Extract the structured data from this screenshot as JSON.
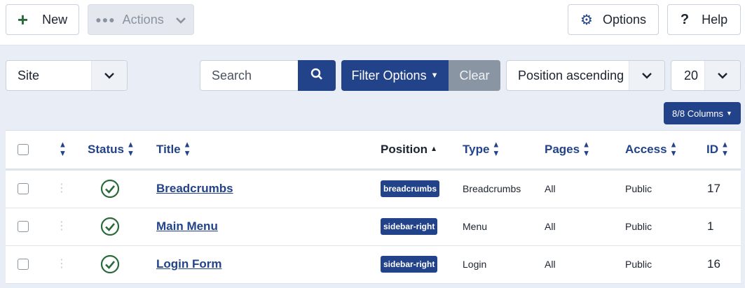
{
  "toolbar": {
    "new_label": "New",
    "actions_label": "Actions",
    "options_label": "Options",
    "help_label": "Help"
  },
  "filters": {
    "site_value": "Site",
    "search_placeholder": "Search",
    "filter_options_label": "Filter Options",
    "clear_label": "Clear",
    "ordering_value": "Position ascending",
    "limit_value": "20",
    "columns_label": "8/8 Columns"
  },
  "table": {
    "headers": {
      "status": "Status",
      "title": "Title",
      "position": "Position",
      "type": "Type",
      "pages": "Pages",
      "access": "Access",
      "id": "ID"
    },
    "rows": [
      {
        "title": "Breadcrumbs",
        "position": "breadcrumbs",
        "type": "Breadcrumbs",
        "pages": "All",
        "access": "Public",
        "id": "17"
      },
      {
        "title": "Main Menu",
        "position": "sidebar-right",
        "type": "Menu",
        "pages": "All",
        "access": "Public",
        "id": "1"
      },
      {
        "title": "Login Form",
        "position": "sidebar-right",
        "type": "Login",
        "pages": "All",
        "access": "Public",
        "id": "16"
      }
    ]
  },
  "colors": {
    "primary": "#22438a",
    "success": "#2b6a3a",
    "clear_bg": "#8a95a4",
    "page_bg": "#e9eef6"
  }
}
